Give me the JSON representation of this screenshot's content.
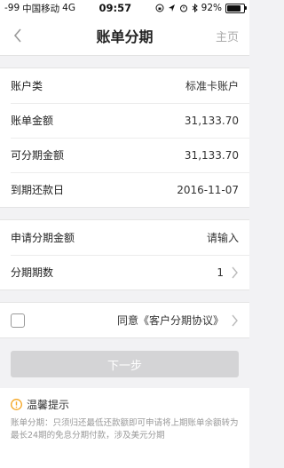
{
  "status_bar": {
    "signal": "-99",
    "carrier": "中国移动",
    "network": "4G",
    "time": "09:57",
    "battery_percent": "92%",
    "battery_level": 0.92
  },
  "nav": {
    "title": "账单分期",
    "home": "主页"
  },
  "info": [
    {
      "label": "账户类",
      "value": "标准卡账户"
    },
    {
      "label": "账单金额",
      "value": "31,133.70"
    },
    {
      "label": "可分期金额",
      "value": "31,133.70"
    },
    {
      "label": "到期还款日",
      "value": "2016-11-07"
    }
  ],
  "apply": {
    "amount_label": "申请分期金额",
    "amount_placeholder": "请输入",
    "periods_label": "分期期数",
    "periods_value": "1"
  },
  "agreement": {
    "text": "同意《客户分期协议》"
  },
  "next_button": "下一步",
  "tips": {
    "title": "温馨提示",
    "body": "账单分期：只须归还最低还款额即可申请将上期账单余额转为最长24期的免息分期付款，涉及美元分期"
  },
  "colors": {
    "warning": "#f5a623",
    "button_disabled": "#d4d4d6"
  }
}
